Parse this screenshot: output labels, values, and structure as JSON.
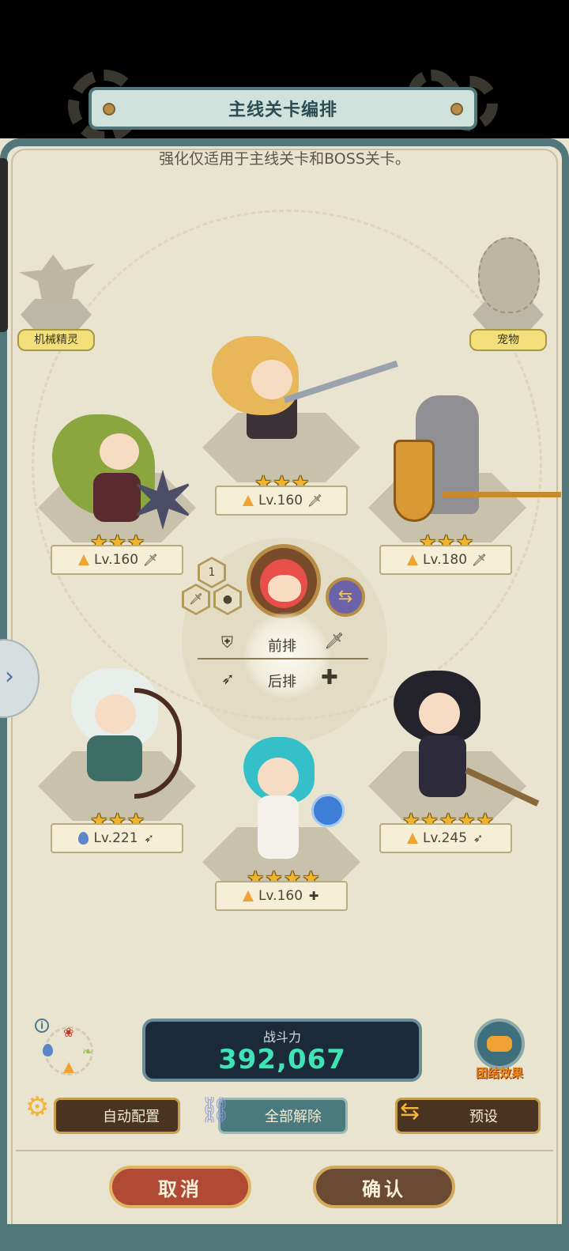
{
  "title": "主线关卡编排",
  "subtitle": "强化仅适用于主线关卡和BOSS关卡。",
  "slots": {
    "mech_label": "机械精灵",
    "pet_label": "宠物"
  },
  "heroes": [
    {
      "id": "top-center",
      "stars": 3,
      "element": "fire",
      "level": "Lv.160",
      "role": "sword"
    },
    {
      "id": "mid-left",
      "stars": 3,
      "element": "fire",
      "level": "Lv.160",
      "role": "sword"
    },
    {
      "id": "mid-right",
      "stars": 3,
      "element": "fire",
      "level": "Lv.180",
      "role": "sword"
    },
    {
      "id": "low-left",
      "stars": 3,
      "element": "water",
      "level": "Lv.221",
      "role": "bow"
    },
    {
      "id": "low-right",
      "stars": 5,
      "element": "fire",
      "level": "Lv.245",
      "role": "bow"
    },
    {
      "id": "bottom-center",
      "stars": 4,
      "element": "fire",
      "level": "Lv.160",
      "role": "plus"
    }
  ],
  "leader": {
    "badge": "1"
  },
  "formation": {
    "front_label": "前排",
    "back_label": "后排"
  },
  "power": {
    "label": "战斗力",
    "value": "392,067"
  },
  "team_effect_label": "团结效果",
  "buttons": {
    "auto": "自动配置",
    "release": "全部解除",
    "preset": "预设",
    "cancel": "取消",
    "confirm": "确认"
  },
  "colors": {
    "accent_teal": "#52777a",
    "power_value": "#3fe3b4",
    "star_gold": "#f1b52d",
    "cancel_red": "#b04a34"
  }
}
